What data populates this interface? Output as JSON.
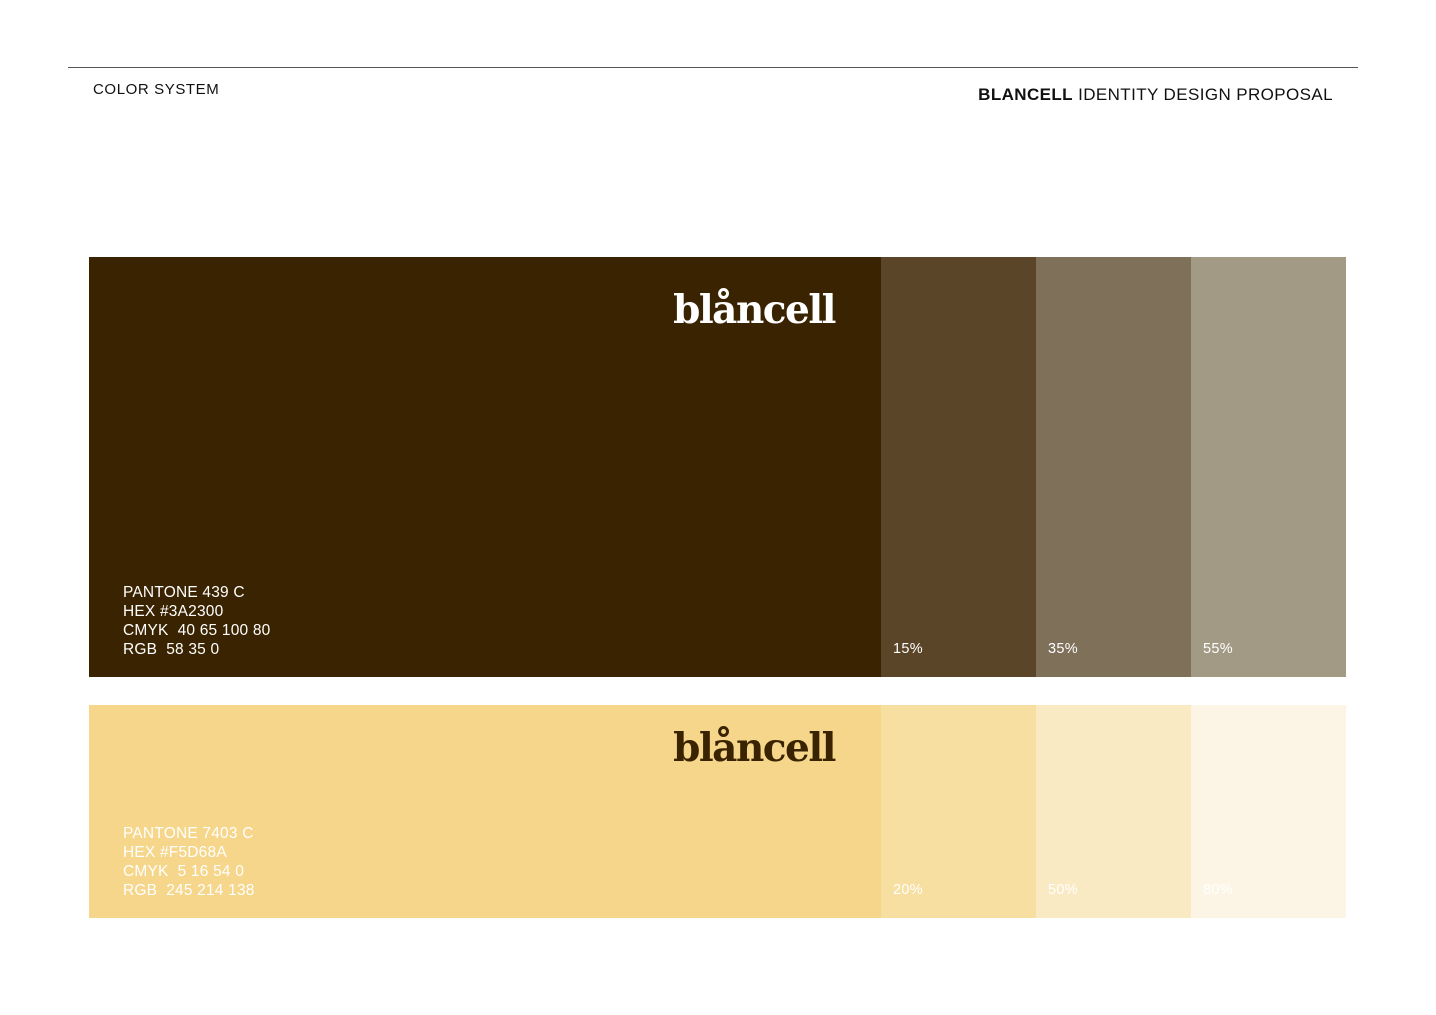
{
  "header": {
    "section_label": "COLOR SYSTEM",
    "doc_title_brand": "BLANCELL",
    "doc_title_rest": " IDENTITY DESIGN PROPOSAL"
  },
  "palettes": [
    {
      "name": "primary",
      "logo_text": "blåncell",
      "main_color": "#3A2300",
      "text_color": "#ffffff",
      "specs": {
        "pantone": "PANTONE 439 C",
        "hex": "HEX #3A2300",
        "cmyk": "CMYK  40 65 100 80",
        "rgb": "RGB  58 35 0"
      },
      "tints": [
        {
          "label": "15%",
          "color": "#5A4528",
          "text_color": "#ffffff"
        },
        {
          "label": "35%",
          "color": "#7F705A",
          "text_color": "#ffffff"
        },
        {
          "label": "55%",
          "color": "#A39A86",
          "text_color": "#ffffff"
        }
      ]
    },
    {
      "name": "secondary",
      "logo_text": "blåncell",
      "main_color": "#F5D68A",
      "logo_color": "#3A2300",
      "text_color": "#ffffff",
      "specs": {
        "pantone": "PANTONE 7403 C",
        "hex": "HEX #F5D68A",
        "cmyk": "CMYK  5 16 54 0",
        "rgb": "RGB  245 214 138"
      },
      "tints": [
        {
          "label": "20%",
          "color": "#F7DEA1",
          "text_color": "#ffffff"
        },
        {
          "label": "50%",
          "color": "#FAEAC4",
          "text_color": "#ffffff"
        },
        {
          "label": "80%",
          "color": "#FCF5E6",
          "text_color": "#ffffff"
        }
      ]
    }
  ]
}
